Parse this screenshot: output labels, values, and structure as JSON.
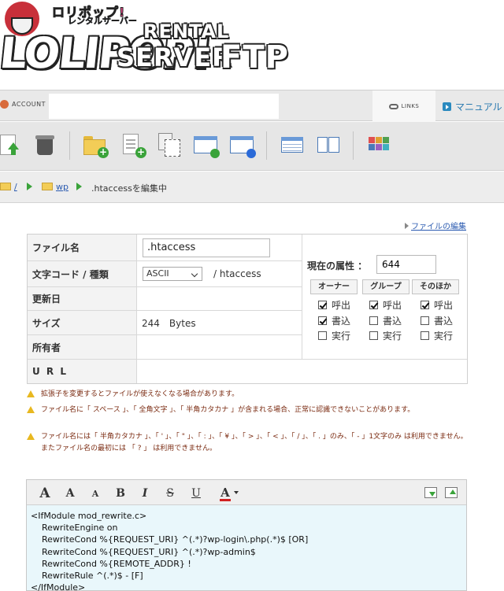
{
  "logo": {
    "small_top": "ロリポップ!",
    "small_sub": "レンタルサーバー",
    "big_text": "LOLIPOP!",
    "rental": "RENTAL",
    "server": "SERVER",
    "ftp": "FTP"
  },
  "account_bar": {
    "account_label": "ACCOUNT",
    "links_label": "LINKS",
    "manual_label": "マニュアル"
  },
  "toolbar_icons": [
    "upload-icon",
    "trash-icon",
    "new-folder-icon",
    "new-file-icon",
    "copy-icon",
    "refresh-window-icon",
    "web-window-icon",
    "list-view-icon",
    "split-view-icon",
    "tile-view-icon"
  ],
  "breadcrumb": {
    "root": "/",
    "folder": "wp",
    "current": ".htaccessを編集中"
  },
  "edit_link": "ファイルの編集",
  "file_info": {
    "rows": [
      {
        "label": "ファイル名"
      },
      {
        "label": "文字コード / 種類"
      },
      {
        "label": "更新日"
      },
      {
        "label": "サイズ"
      },
      {
        "label": "所有者"
      },
      {
        "label": "U R L"
      }
    ],
    "filename": ".htaccess",
    "encoding": "ASCII",
    "type": "/ htaccess",
    "size": "244　Bytes"
  },
  "permissions": {
    "label": "現在の属性 ：",
    "value": "644",
    "groups": [
      "オーナー",
      "グループ",
      "そのほか"
    ],
    "read_label": "呼出",
    "write_label": "書込",
    "exec_label": "実行",
    "owner": {
      "read": true,
      "write": true,
      "exec": false
    },
    "group": {
      "read": true,
      "write": false,
      "exec": false
    },
    "other": {
      "read": true,
      "write": false,
      "exec": false
    }
  },
  "warnings": [
    "拡張子を変更するとファイルが使えなくなる場合があります。",
    "ファイル名に「 スペース 」、「 全角文字 」、「 半角カタカナ 」が含まれる場合、正常に認識できないことがあります。",
    "ファイル名には「 半角カタカナ 」、「 ' 」、「 \" 」、「 : 」、「 ¥ 」、「 > 」、「 < 」、「 / 」、「 . 」のみ、「 - 」1文字のみ は利用できません。またファイル名の最初には 「 ? 」 は利用できません。"
  ],
  "editor": {
    "format_buttons": [
      "A",
      "A",
      "A",
      "B",
      "I",
      "S",
      "U",
      "A"
    ],
    "content_lines": [
      "<IfModule mod_rewrite.c>",
      "    RewriteEngine on",
      "    RewriteCond %{REQUEST_URI} ^(.*)?wp-login\\.php(.*)$ [OR]",
      "    RewriteCond %{REQUEST_URI} ^(.*)?wp-admin$",
      "    RewriteCond %{REMOTE_ADDR} !",
      "    RewriteRule ^(.*)$ - [F]",
      "</IfModule>"
    ]
  },
  "colors": {
    "accent_link": "#2a5ab0",
    "warning_text": "#7a2a10",
    "editor_bg": "#e9f7fb",
    "check_green": "#3aa33a"
  }
}
